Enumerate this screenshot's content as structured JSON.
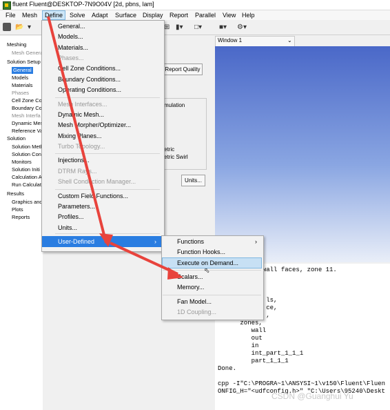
{
  "window": {
    "title": "fluent Fluent@DESKTOP-7N9O04V  [2d, pbns, lam]"
  },
  "menubar": [
    "File",
    "Mesh",
    "Define",
    "Solve",
    "Adapt",
    "Surface",
    "Display",
    "Report",
    "Parallel",
    "View",
    "Help"
  ],
  "tree": [
    {
      "label": "Meshing",
      "level": 0,
      "dim": false,
      "selected": false
    },
    {
      "label": "Mesh Genera",
      "level": 1,
      "dim": true,
      "selected": false
    },
    {
      "label": "Solution Setup",
      "level": 0,
      "dim": false,
      "selected": false
    },
    {
      "label": "General",
      "level": 1,
      "dim": false,
      "selected": true
    },
    {
      "label": "Models",
      "level": 1,
      "dim": false,
      "selected": false
    },
    {
      "label": "Materials",
      "level": 1,
      "dim": false,
      "selected": false
    },
    {
      "label": "Phases",
      "level": 1,
      "dim": true,
      "selected": false
    },
    {
      "label": "Cell Zone Co",
      "level": 1,
      "dim": false,
      "selected": false
    },
    {
      "label": "Boundary Co",
      "level": 1,
      "dim": false,
      "selected": false
    },
    {
      "label": "Mesh Interfa",
      "level": 1,
      "dim": true,
      "selected": false
    },
    {
      "label": "Dynamic Mes",
      "level": 1,
      "dim": false,
      "selected": false
    },
    {
      "label": "Reference Va",
      "level": 1,
      "dim": false,
      "selected": false
    },
    {
      "label": "Solution",
      "level": 0,
      "dim": false,
      "selected": false
    },
    {
      "label": "Solution Meth",
      "level": 1,
      "dim": false,
      "selected": false
    },
    {
      "label": "Solution Con",
      "level": 1,
      "dim": false,
      "selected": false
    },
    {
      "label": "Monitors",
      "level": 1,
      "dim": false,
      "selected": false
    },
    {
      "label": "Solution Initi",
      "level": 1,
      "dim": false,
      "selected": false
    },
    {
      "label": "Calculation A",
      "level": 1,
      "dim": false,
      "selected": false
    },
    {
      "label": "Run Calculati",
      "level": 1,
      "dim": false,
      "selected": false
    },
    {
      "label": "Results",
      "level": 0,
      "dim": false,
      "selected": false
    },
    {
      "label": "Graphics and",
      "level": 1,
      "dim": false,
      "selected": false
    },
    {
      "label": "Plots",
      "level": 1,
      "dim": false,
      "selected": false
    },
    {
      "label": "Reports",
      "level": 1,
      "dim": false,
      "selected": false
    }
  ],
  "panel": {
    "report_quality": "Report Quality",
    "peek_simulation": "mulation",
    "peek_metric": "etric",
    "peek_metric_swirl": "etric Swirl",
    "units": "Units..."
  },
  "graphics": {
    "window_label": "Window 1"
  },
  "define_menu": [
    {
      "label": "General...",
      "dim": false
    },
    {
      "label": "Models...",
      "dim": false
    },
    {
      "label": "Materials...",
      "dim": false
    },
    {
      "label": "Phases...",
      "dim": true
    },
    {
      "label": "Cell Zone Conditions...",
      "dim": false
    },
    {
      "label": "Boundary Conditions...",
      "dim": false
    },
    {
      "label": "Operating Conditions...",
      "dim": false
    },
    {
      "label": "Mesh Interfaces...",
      "dim": true
    },
    {
      "label": "Dynamic Mesh...",
      "dim": false
    },
    {
      "label": "Mesh Morpher/Optimizer...",
      "dim": false
    },
    {
      "label": "Mixing Planes...",
      "dim": false
    },
    {
      "label": "Turbo Topology...",
      "dim": true
    },
    {
      "label": "Injections...",
      "dim": false
    },
    {
      "label": "DTRM Rays...",
      "dim": true
    },
    {
      "label": "Shell Conduction Manager...",
      "dim": true
    },
    {
      "label": "Custom Field Functions...",
      "dim": false
    },
    {
      "label": "Parameters...",
      "dim": false
    },
    {
      "label": "Profiles...",
      "dim": false
    },
    {
      "label": "Units...",
      "dim": false
    },
    {
      "label": "User-Defined",
      "dim": false
    }
  ],
  "user_defined_menu": [
    {
      "label": "Functions",
      "dim": false
    },
    {
      "label": "Function Hooks...",
      "dim": false
    },
    {
      "label": "Execute on Demand...",
      "dim": false
    },
    {
      "label": "Scalars...",
      "dim": false
    },
    {
      "label": "Memory...",
      "dim": false
    },
    {
      "label": "Fan Model...",
      "dim": false
    },
    {
      "label": "1D Coupling...",
      "dim": true
    }
  ],
  "console_lines": [
    "            wall faces, zone 11.",
    "",
    "",
    "",
    "             ls,",
    "             ce,",
    "             ,",
    "      zones,",
    "         wall",
    "         out",
    "         in",
    "         int_part_1_1_1",
    "         part_1_1_1",
    "Done.",
    "",
    "cpp -I\"C:\\PROGRA~1\\ANSYSI~1\\v150\\Fluent\\Fluen",
    "ONFIG_H=\"<udfconfig.h>\" \"C:\\Users\\95240\\Deskt"
  ],
  "watermark": "CSDN @Guanghui Yu",
  "colors": {
    "highlight": "#2a7de1",
    "hover": "#c7e0f4",
    "annotation_arrow": "#e8433c"
  }
}
